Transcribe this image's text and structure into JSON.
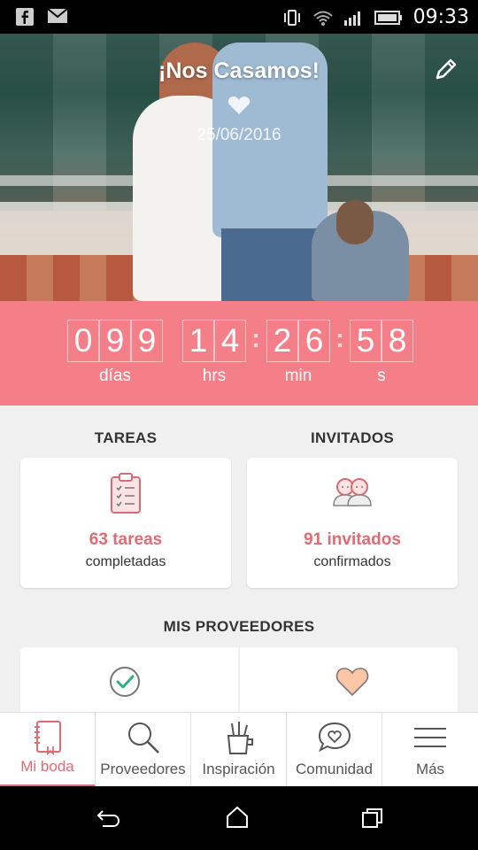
{
  "status_bar": {
    "time": "09:33"
  },
  "hero": {
    "title": "¡Nos Casamos!",
    "date": "25/06/2016"
  },
  "countdown": {
    "days": [
      "0",
      "9",
      "9"
    ],
    "hours": [
      "1",
      "4"
    ],
    "minutes": [
      "2",
      "6"
    ],
    "seconds": [
      "5",
      "8"
    ],
    "separator": ":",
    "labels": {
      "days": "días",
      "hours": "hrs",
      "minutes": "min",
      "seconds": "s"
    }
  },
  "tareas": {
    "heading": "TAREAS",
    "value": "63 tareas",
    "sub": "completadas"
  },
  "invitados": {
    "heading": "INVITADOS",
    "value": "91 invitados",
    "sub": "confirmados"
  },
  "proveedores": {
    "heading": "MIS PROVEEDORES"
  },
  "bottom_nav": [
    {
      "label": "Mi boda",
      "icon": "notebook-icon",
      "active": true
    },
    {
      "label": "Proveedores",
      "icon": "search-icon"
    },
    {
      "label": "Inspiración",
      "icon": "brushes-icon"
    },
    {
      "label": "Comunidad",
      "icon": "chat-heart-icon"
    },
    {
      "label": "Más",
      "icon": "menu-icon"
    }
  ],
  "colors": {
    "accent": "#f57f88",
    "accent_text": "#e06b72"
  }
}
